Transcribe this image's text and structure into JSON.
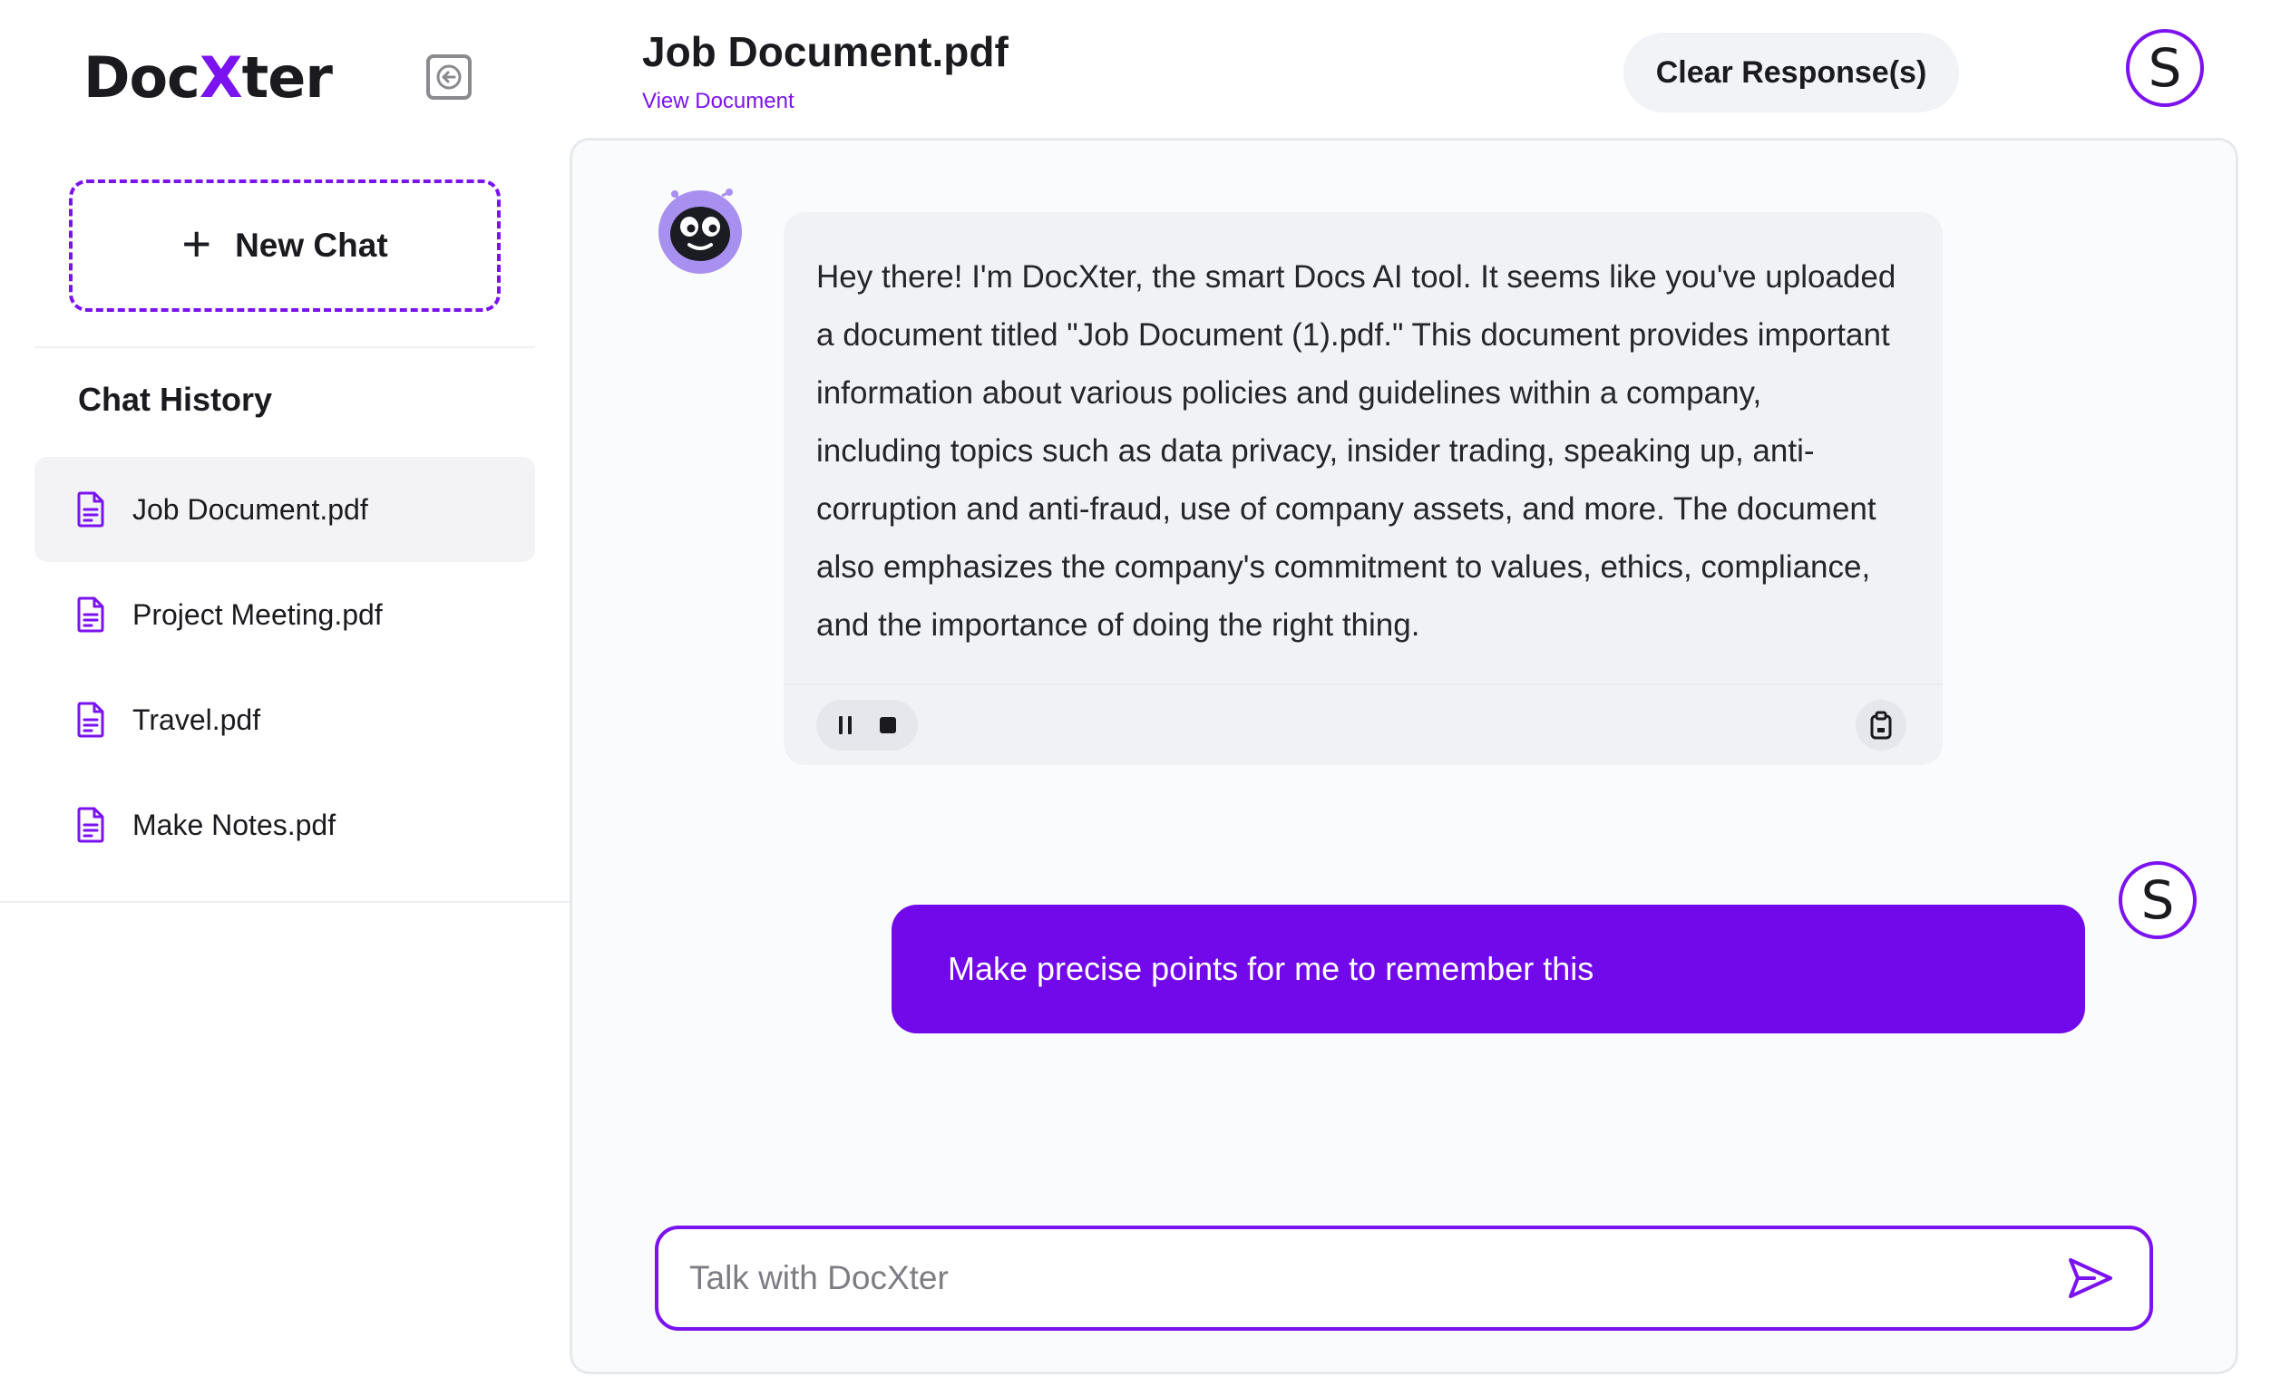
{
  "brand": {
    "logo_prefix": "Doc",
    "logo_x": "X",
    "logo_suffix": "ter",
    "accent_color": "#7b12f0"
  },
  "sidebar": {
    "new_chat_label": "New Chat",
    "history_title": "Chat History",
    "items": [
      {
        "label": "Job Document.pdf",
        "active": true
      },
      {
        "label": "Project Meeting.pdf",
        "active": false
      },
      {
        "label": "Travel.pdf",
        "active": false
      },
      {
        "label": "Make Notes.pdf",
        "active": false
      }
    ]
  },
  "header": {
    "title": "Job Document.pdf",
    "view_link": "View Document",
    "clear_label": "Clear Response(s)",
    "avatar_initial": "S"
  },
  "chat": {
    "messages": [
      {
        "role": "assistant",
        "text": "Hey there! I'm DocXter, the smart Docs AI tool. It seems like you've uploaded\na document titled \"Job Document (1).pdf.\" This document provides important\ninformation about various policies and guidelines within a company,\nincluding topics such as data privacy, insider trading, speaking up, anti-\ncorruption and anti-fraud, use of company assets, and more. The document\nalso emphasizes the company's commitment to values, ethics, compliance,\nand the importance of doing the right thing."
      },
      {
        "role": "user",
        "text": "Make precise points for me to remember this",
        "avatar_initial": "S"
      }
    ],
    "controls": {
      "pause_icon": "pause-icon",
      "stop_icon": "stop-icon",
      "copy_icon": "clipboard-icon"
    }
  },
  "composer": {
    "placeholder": "Talk with DocXter",
    "value": "",
    "send_icon": "send-icon"
  }
}
